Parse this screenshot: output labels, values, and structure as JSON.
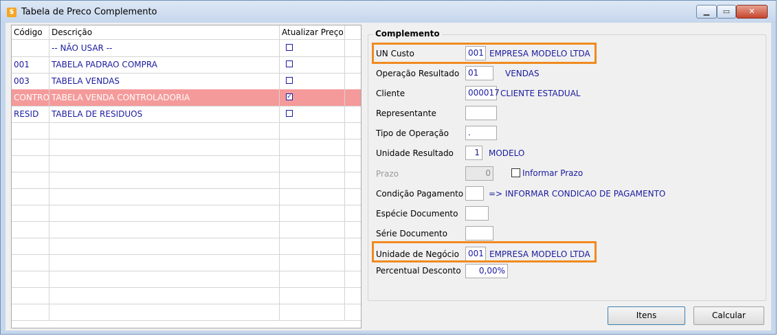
{
  "window": {
    "title": "Tabela de Preco Complemento"
  },
  "grid": {
    "headers": [
      "Código",
      "Descrição",
      "Atualizar Preço"
    ],
    "rows": [
      {
        "code": "",
        "desc": "-- NÃO USAR --",
        "checked": false
      },
      {
        "code": "001",
        "desc": "TABELA PADRAO COMPRA",
        "checked": false
      },
      {
        "code": "003",
        "desc": "TABELA VENDAS",
        "checked": false
      },
      {
        "code": "CONTRO",
        "desc": "TABELA VENDA CONTROLADORIA",
        "checked": true
      },
      {
        "code": "RESID",
        "desc": "TABELA DE RESIDUOS",
        "checked": false
      }
    ]
  },
  "complemento": {
    "title": "Complemento",
    "un_custo": {
      "label": "UN Custo",
      "value": "001",
      "desc": "EMPRESA MODELO LTDA"
    },
    "operacao_resultado": {
      "label": "Operação Resultado",
      "value": "01",
      "desc": "VENDAS"
    },
    "cliente": {
      "label": "Cliente",
      "value": "000017",
      "desc": "CLIENTE ESTADUAL"
    },
    "representante": {
      "label": "Representante",
      "value": ""
    },
    "tipo_operacao": {
      "label": "Tipo de Operação",
      "value": "."
    },
    "unidade_resultado": {
      "label": "Unidade Resultado",
      "value": "1",
      "desc": "MODELO"
    },
    "prazo": {
      "label": "Prazo",
      "value": "0",
      "check_label": "Informar Prazo"
    },
    "condicao_pagamento": {
      "label": "Condição Pagamento",
      "value": "",
      "desc": "=> INFORMAR CONDICAO DE PAGAMENTO"
    },
    "especie_documento": {
      "label": "Espécie Documento",
      "value": ""
    },
    "serie_documento": {
      "label": "Série Documento",
      "value": ""
    },
    "unidade_negocio": {
      "label": "Unidade de Negócio",
      "value": "001",
      "desc": "EMPRESA MODELO LTDA"
    },
    "percentual_desconto": {
      "label": "Percentual Desconto",
      "value": "0,00%"
    }
  },
  "buttons": {
    "itens": "Itens",
    "calcular": "Calcular"
  },
  "colors": {
    "highlight": "#f08a1e",
    "selected_row": "#f59a9a",
    "value_text": "#1a1aa0"
  }
}
